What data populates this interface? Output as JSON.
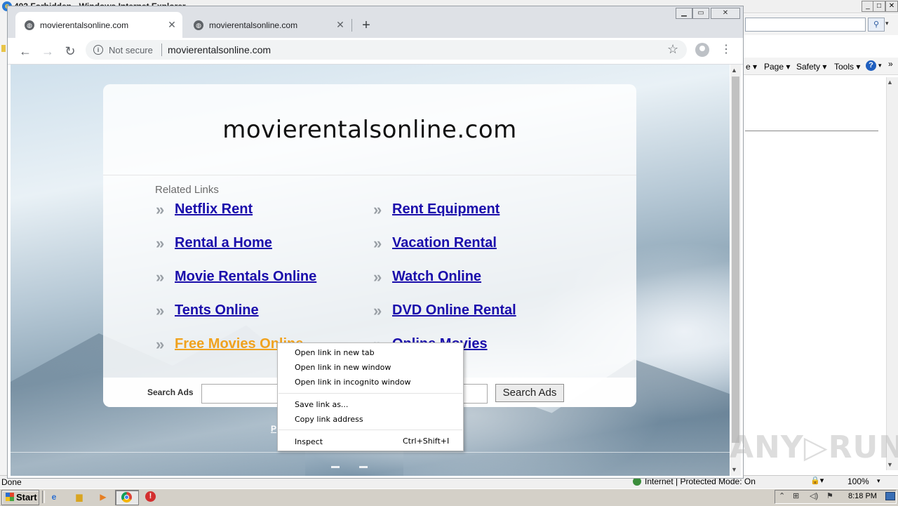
{
  "ie": {
    "window_title": "403 Forbidden - Windows Internet Explorer",
    "window_controls": {
      "minimize": "_",
      "maximize": "□",
      "close": "✕"
    },
    "command_bar": {
      "page": "Page ▾",
      "safety": "Safety ▾",
      "tools": "Tools ▾",
      "help_icon": "?",
      "e_glyph": "e ▾",
      "chevron": "»"
    },
    "status": {
      "left": "Done",
      "zone": "Internet | Protected Mode: On",
      "zoom": "100%",
      "zoom_drop": "▾"
    }
  },
  "chrome": {
    "tabs": [
      {
        "title": "movierentalsonline.com",
        "active": true
      },
      {
        "title": "movierentalsonline.com",
        "active": false
      }
    ],
    "tab_close_glyph": "✕",
    "new_tab_glyph": "+",
    "window_controls": {
      "minimize": "▁",
      "restore": "▭",
      "close": "✕"
    },
    "toolbar": {
      "back": "←",
      "forward": "→",
      "reload": "↻",
      "star": "☆",
      "menu": "⋮"
    },
    "omnibox": {
      "security_label": "Not secure",
      "url": "movierentalsonline.com",
      "info_glyph": "i"
    },
    "scroll": {
      "up": "▲",
      "down": "▼"
    }
  },
  "page": {
    "domain_title": "movierentalsonline.com",
    "related_heading": "Related Links",
    "arrow_glyph": "»",
    "links_left": [
      "Netflix Rent",
      "Rental a Home",
      "Movie Rentals Online",
      "Tents Online",
      "Free Movies Online"
    ],
    "links_right": [
      "Rent Equipment",
      "Vacation Rental",
      "Watch Online",
      "DVD Online Rental",
      "Online Movies"
    ],
    "hovered_link": "Free Movies Online",
    "search": {
      "label": "Search Ads",
      "button": "Search Ads",
      "value": ""
    },
    "footer_left": "P",
    "footer_right": "."
  },
  "context_menu": {
    "items": [
      "Open link in new tab",
      "Open link in new window",
      "Open link in incognito window",
      "Save link as...",
      "Copy link address",
      "Inspect"
    ],
    "inspect_shortcut": "Ctrl+Shift+I"
  },
  "watermark": "ANY▷RUN",
  "taskbar": {
    "start_label": "Start",
    "clock": "8:18 PM",
    "icons": [
      "ie-icon",
      "explorer-icon",
      "media-player-icon",
      "chrome-icon",
      "stop-icon"
    ],
    "tray": {
      "up": "⌃",
      "net": "⊞",
      "vol": "◁)",
      "flag": "⚑"
    }
  }
}
